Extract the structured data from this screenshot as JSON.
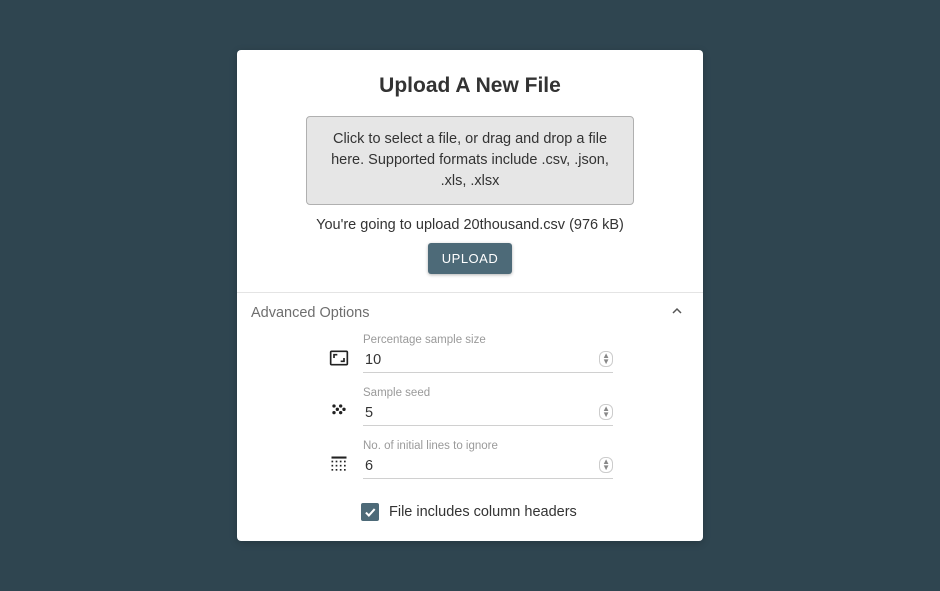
{
  "title": "Upload A New File",
  "dropzone_text": "Click to select a file, or drag and drop a file here. Supported formats include .csv, .json, .xls, .xlsx",
  "status_text": "You're going to upload 20thousand.csv (976 kB)",
  "upload_button_label": "UPLOAD",
  "accordion_title": "Advanced Options",
  "fields": {
    "sample_size": {
      "label": "Percentage sample size",
      "value": "10"
    },
    "sample_seed": {
      "label": "Sample seed",
      "value": "5"
    },
    "skip_lines": {
      "label": "No. of initial lines to ignore",
      "value": "6"
    }
  },
  "headers_checkbox": {
    "label": "File includes column headers",
    "checked": true
  }
}
